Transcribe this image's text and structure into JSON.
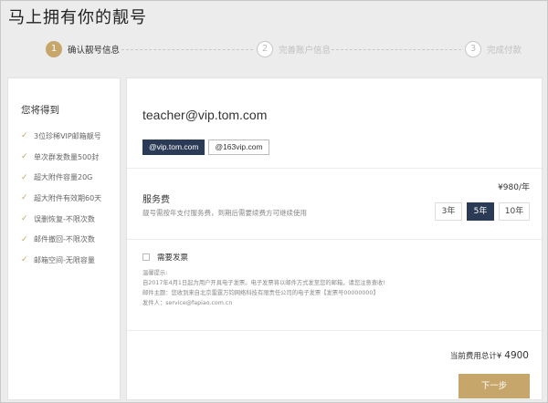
{
  "page": {
    "title": "马上拥有你的靓号"
  },
  "steps": [
    {
      "num": "1",
      "label": "确认靓号信息",
      "active": true
    },
    {
      "num": "2",
      "label": "完善账户信息",
      "active": false
    },
    {
      "num": "3",
      "label": "完成付款",
      "active": false
    }
  ],
  "sidebar": {
    "title": "您将得到",
    "benefits": [
      "3位珍稀VIP邮箱靓号",
      "单次群发数量500封",
      "超大附件容量20G",
      "超大附件有效期60天",
      "误删恢复-不限次数",
      "邮件撤回-不限次数",
      "邮箱空间-无限容量"
    ]
  },
  "account": {
    "email": "teacher@vip.tom.com",
    "domains": [
      "@vip.tom.com",
      "@163vip.com"
    ]
  },
  "fee": {
    "price": "¥980/年",
    "title": "服务费",
    "description": "靓号需按年支付服务费，到期后需要续费方可继续使用",
    "years": [
      "3年",
      "5年",
      "10年"
    ]
  },
  "invoice": {
    "label": "需要发票",
    "notice": [
      "温馨提示:",
      "自2017年4月1日起为用户开具电子发票。电子发票将以邮件方式发至您的邮箱，请您注意查收!",
      "邮件主题：您收到来自北京雷霆万钧网络科技有限责任公司的电子发票【发票号00000000】",
      "发件人：service@fapiao.com.cn"
    ]
  },
  "summary": {
    "total_label": "当前费用总计¥",
    "total_amount": "4900",
    "next_label": "下一步"
  }
}
